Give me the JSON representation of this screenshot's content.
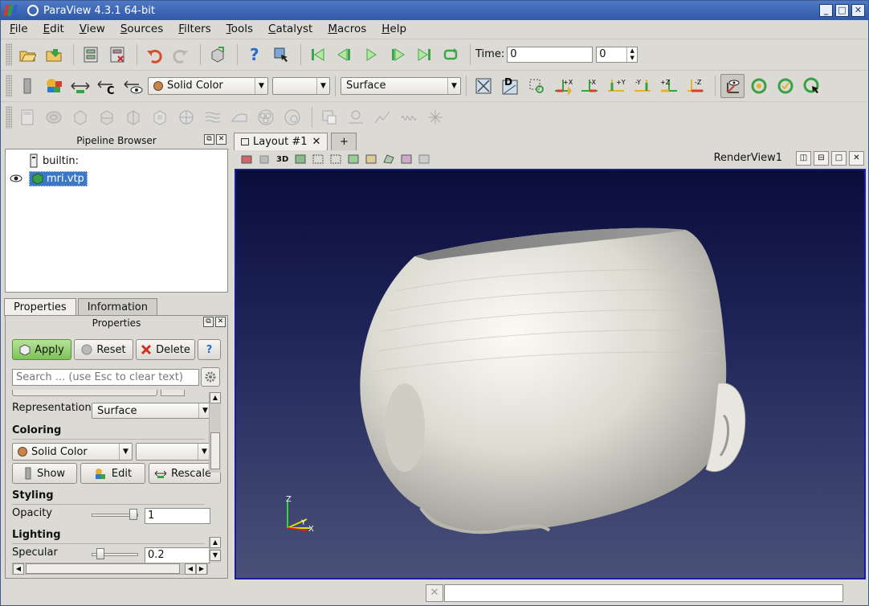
{
  "window": {
    "title": "ParaView 4.3.1 64-bit"
  },
  "menu": [
    "File",
    "Edit",
    "View",
    "Sources",
    "Filters",
    "Tools",
    "Catalyst",
    "Macros",
    "Help"
  ],
  "time": {
    "label": "Time:",
    "value": "0",
    "step": "0"
  },
  "toolbar2": {
    "color_by": "Solid Color",
    "component": "",
    "representation": "Surface"
  },
  "pipeline": {
    "title": "Pipeline Browser",
    "items": [
      {
        "label": "builtin:"
      },
      {
        "label": "mri.vtp"
      }
    ]
  },
  "tabs": {
    "properties": "Properties",
    "information": "Information"
  },
  "properties": {
    "title": "Properties",
    "apply": "Apply",
    "reset": "Reset",
    "delete": "Delete",
    "help": "?",
    "search_placeholder": "Search ... (use Esc to clear text)",
    "representation_label": "Representation",
    "representation_value": "Surface",
    "coloring_title": "Coloring",
    "coloring_value": "Solid Color",
    "show": "Show",
    "edit": "Edit",
    "rescale": "Rescale",
    "styling_title": "Styling",
    "opacity_label": "Opacity",
    "opacity_value": "1",
    "lighting_title": "Lighting",
    "specular_label": "Specular",
    "specular_value": "0.2"
  },
  "layout": {
    "tab": "Layout #1",
    "add": "+"
  },
  "view": {
    "name": "RenderView1",
    "toolbar_3d": "3D"
  },
  "axes": {
    "z": "Z",
    "y": "Y",
    "x": "X"
  },
  "colors": {
    "title_bar": "#3d66b5",
    "apply_green": "#8fd06b",
    "render_top": "#0a0d3a",
    "render_bottom": "#4a5178",
    "selection_blue": "#3c78c8"
  }
}
